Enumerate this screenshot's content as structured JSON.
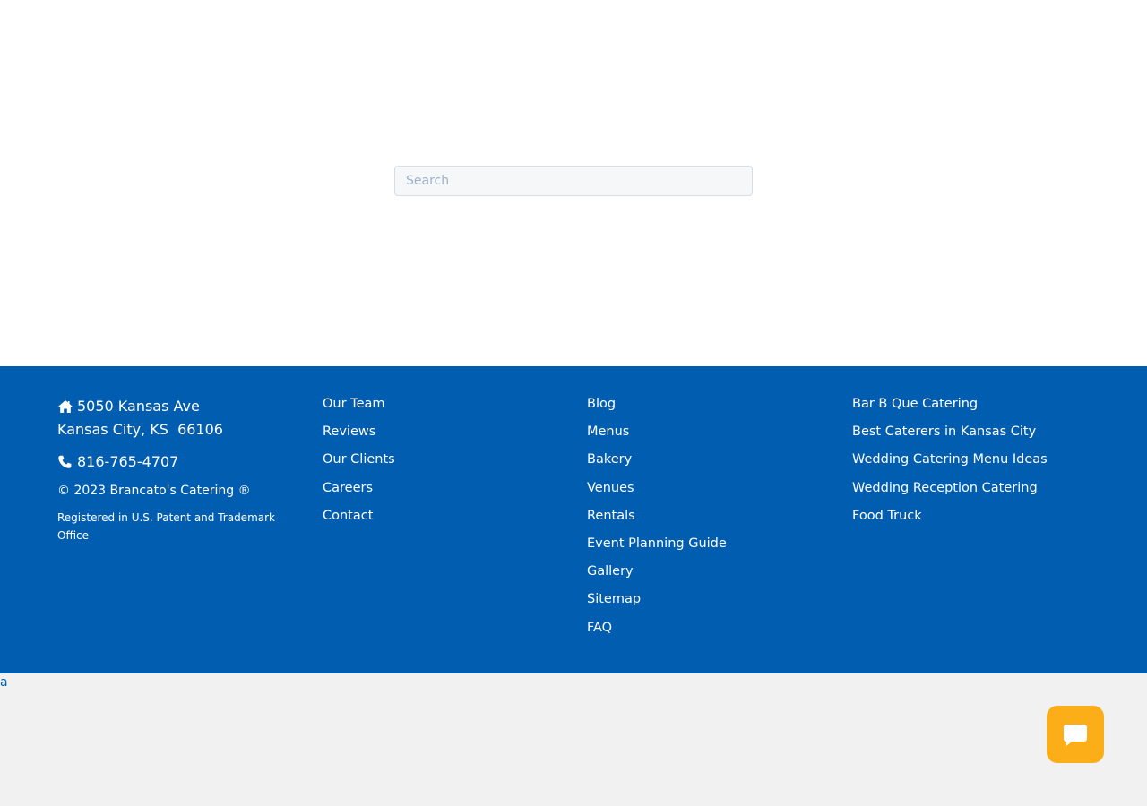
{
  "search": {
    "placeholder": "Search"
  },
  "footer": {
    "address_line1": "5050 Kansas Ave",
    "address_line2": "Kansas City, KS  66106",
    "phone": "816-765-4707",
    "copyright": "© 2023 Brancato's Catering ®",
    "registered": "Registered in U.S. Patent and Trademark Office",
    "col2_links": [
      "Our Team",
      "Reviews",
      "Our Clients",
      "Careers",
      "Contact"
    ],
    "col3_links": [
      "Blog",
      "Menus",
      "Bakery",
      "Venues",
      "Rentals",
      "Event Planning Guide",
      "Gallery",
      "Sitemap",
      "FAQ"
    ],
    "col4_links": [
      "Bar B Que Catering",
      "Best Caterers in Kansas City",
      "Wedding Catering Menu Ideas",
      "Wedding Reception Catering",
      "Food Truck"
    ]
  },
  "bottom": {
    "stray_link": "a"
  },
  "icons": {
    "address": "home-icon",
    "phone": "phone-icon",
    "chat": "chat-bubble-icon"
  },
  "colors": {
    "footer_bg": "#015daf",
    "chat_button": "#fbae17",
    "page_bg": "#f1f1f1"
  }
}
